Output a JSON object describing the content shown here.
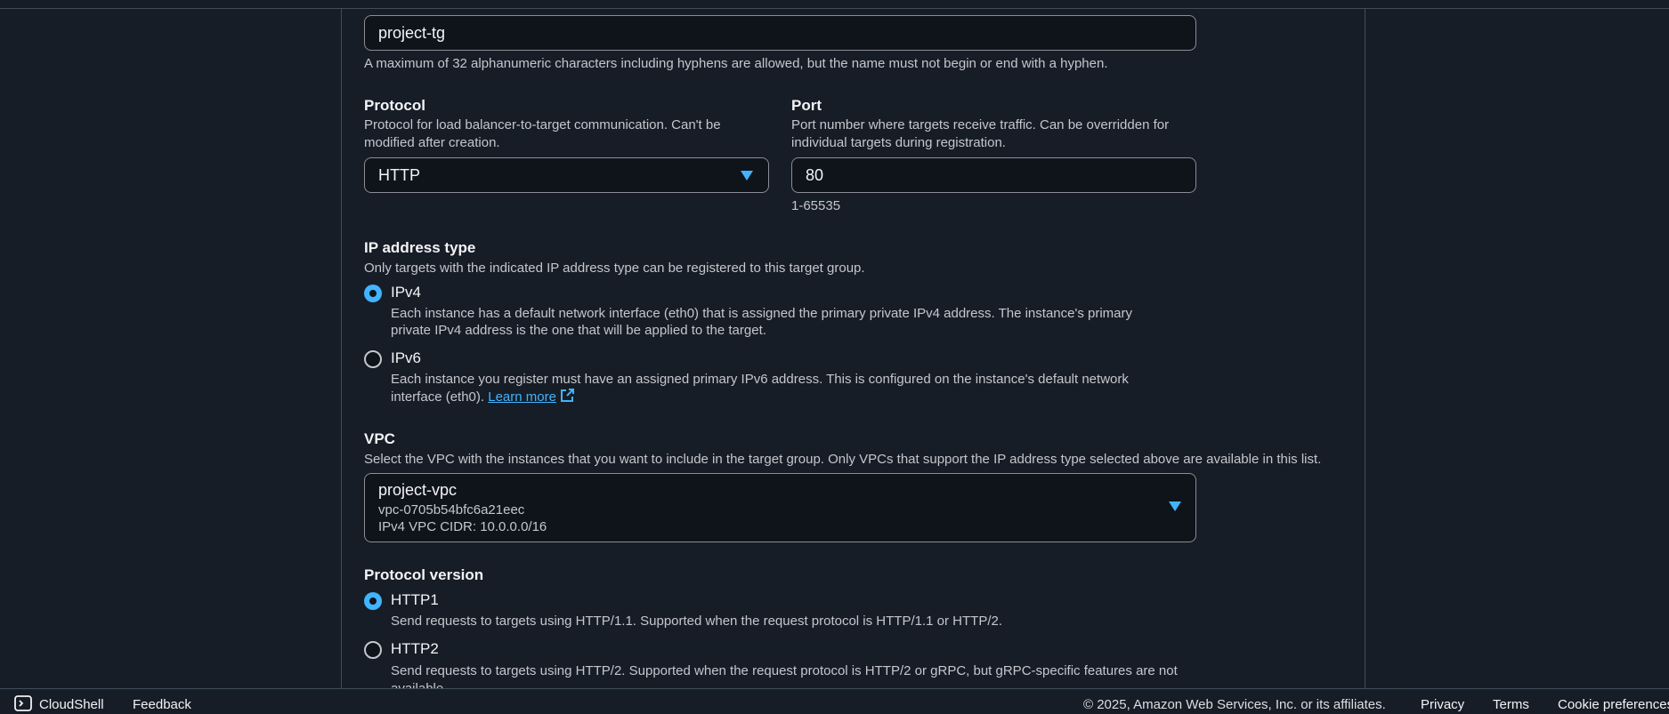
{
  "target_group": {
    "name_value": "project-tg",
    "name_hint": "A maximum of 32 alphanumeric characters including hyphens are allowed, but the name must not begin or end with a hyphen."
  },
  "protocol": {
    "label": "Protocol",
    "description_line1": "Protocol for load balancer-to-target communication. Can't be",
    "description_line2": "modified after creation.",
    "selected": "HTTP",
    "icon": "caret-down-icon"
  },
  "port": {
    "label": "Port",
    "description_line1": "Port number where targets receive traffic. Can be overridden for",
    "description_line2": "individual targets during registration.",
    "value": "80",
    "range_hint": "1-65535"
  },
  "ip_address_type": {
    "label": "IP address type",
    "description": "Only targets with the indicated IP address type can be registered to this target group.",
    "options": [
      {
        "label": "IPv4",
        "checked": true,
        "description_line1": "Each instance has a default network interface (eth0) that is assigned the primary private IPv4 address. The instance's primary",
        "description_line2": "private IPv4 address is the one that will be applied to the target."
      },
      {
        "label": "IPv6",
        "checked": false,
        "description_line1": "Each instance you register must have an assigned primary IPv6 address. This is configured on the instance's default network",
        "description_line2": "interface (eth0).",
        "link": "Learn more"
      }
    ]
  },
  "vpc": {
    "label": "VPC",
    "description": "Select the VPC with the instances that you want to include in the target group. Only VPCs that support the IP address type selected above are available in this list.",
    "selected_name": "project-vpc",
    "selected_id": "vpc-0705b54bfc6a21eec",
    "selected_cidr": "IPv4 VPC CIDR: 10.0.0.0/16"
  },
  "protocol_version": {
    "label": "Protocol version",
    "options": [
      {
        "label": "HTTP1",
        "checked": true,
        "description_line1": "Send requests to targets using HTTP/1.1. Supported when the request protocol is HTTP/1.1 or HTTP/2."
      },
      {
        "label": "HTTP2",
        "checked": false,
        "description_line1": "Send requests to targets using HTTP/2. Supported when the request protocol is HTTP/2 or gRPC, but gRPC-specific features are not",
        "description_line2": "available."
      }
    ]
  },
  "footer": {
    "cloudshell": "CloudShell",
    "feedback": "Feedback",
    "copyright": "© 2025, Amazon Web Services, Inc. or its affiliates.",
    "privacy": "Privacy",
    "terms": "Terms",
    "cookie": "Cookie preferences"
  },
  "colors": {
    "background": "#161d26",
    "accent": "#42b4ff",
    "border": "#8c8c94"
  }
}
